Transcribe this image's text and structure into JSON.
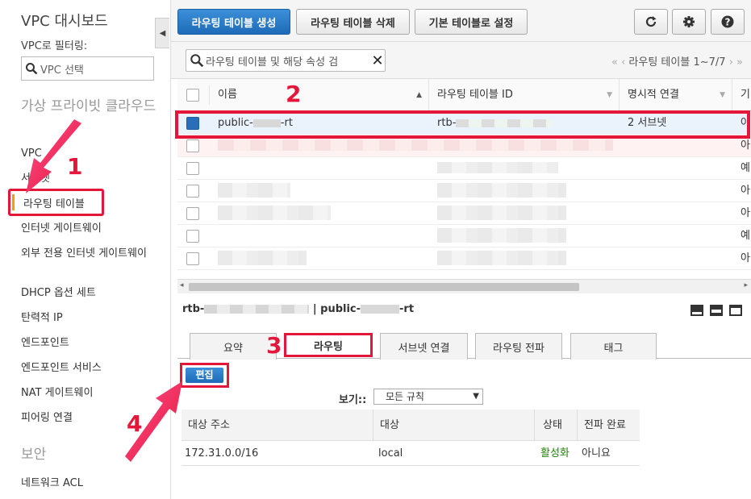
{
  "sidebar": {
    "title": "VPC 대시보드",
    "filter_label": "VPC로 필터링:",
    "filter_placeholder": "VPC 선택",
    "section_vpc": "가상 프라이빗 클라우드",
    "items": {
      "vpc": "VPC",
      "subnets": "서브넷",
      "route_tables": "라우팅 테이블",
      "igw": "인터넷 게이트웨이",
      "egress_igw": "외부 전용 인터넷 게이트웨이",
      "dhcp": "DHCP 옵션 세트",
      "eip": "탄력적 IP",
      "endpoints": "엔드포인트",
      "endpoint_services": "엔드포인트 서비스",
      "nat": "NAT 게이트웨이",
      "peering": "피어링 연결",
      "nacl": "네트워크 ACL"
    },
    "section_security": "보안"
  },
  "toolbar": {
    "create": "라우팅 테이블 생성",
    "delete": "라우팅 테이블 삭제",
    "set_main": "기본 테이블로 설정"
  },
  "search": {
    "placeholder": "라우팅 테이블 및 해당 속성 검",
    "pager": "라우팅 테이블 1~7/7"
  },
  "table": {
    "headers": {
      "name": "이름",
      "id": "라우팅 테이블 ID",
      "explicit": "명시적 연결",
      "main": "기"
    },
    "selected_row": {
      "name": "public-",
      "name_suffix": "-rt",
      "id": "rtb-",
      "explicit": "2 서브넷",
      "main": "아"
    },
    "main_col": [
      "아",
      "예",
      "아",
      "아",
      "예",
      "아"
    ]
  },
  "detail": {
    "title_prefix": "rtb-",
    "title_sep": "| public-",
    "title_suffix": "-rt",
    "tabs": [
      "요약",
      "라우팅",
      "서브넷 연결",
      "라우팅 전파",
      "태그"
    ],
    "edit": "편집",
    "view_label": "보기::",
    "view_option": "모든 규칙",
    "route_headers": {
      "dest": "대상 주소",
      "target": "대상",
      "status": "상태",
      "propagated": "전파 완료"
    },
    "route_row": {
      "dest": "172.31.0.0/16",
      "target": "local",
      "status": "활성화",
      "propagated": "아니요"
    }
  },
  "annotations": [
    "1",
    "2",
    "3",
    "4"
  ],
  "colors": {
    "accent": "#e4173b",
    "primary": "#1e6bb8",
    "status_active": "#1d8102"
  }
}
